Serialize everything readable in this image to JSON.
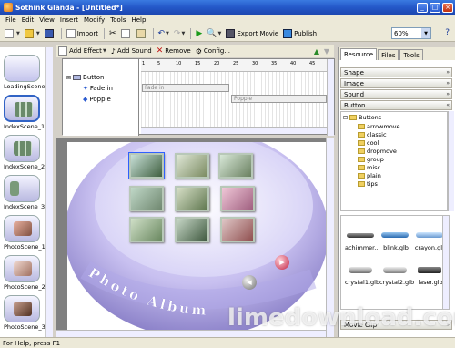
{
  "window": {
    "title": "Sothink Glanda - [Untitled*]"
  },
  "menu": [
    "File",
    "Edit",
    "View",
    "Insert",
    "Modify",
    "Tools",
    "Help"
  ],
  "toolbar": {
    "import_label": "Import",
    "export_label": "Export Movie",
    "publish_label": "Publish",
    "zoom_value": "60%"
  },
  "effects_bar": {
    "add_effect": "Add Effect",
    "add_sound": "Add Sound",
    "remove": "Remove",
    "config": "Config..."
  },
  "timeline": {
    "rows": [
      "Button",
      "Fade in",
      "Popple"
    ],
    "ruler": [
      "1",
      "5",
      "10",
      "15",
      "20",
      "25",
      "30",
      "35",
      "40",
      "45"
    ],
    "bars": [
      "Fade in",
      "Popple"
    ]
  },
  "scenes": [
    "LoadingScene",
    "IndexScene_1",
    "IndexScene_2",
    "IndexScene_3",
    "PhotoScene_1",
    "PhotoScene_2",
    "PhotoScene_3"
  ],
  "canvas": {
    "curve_text": "Photo Album"
  },
  "right_panel": {
    "tabs": [
      "Resource",
      "Files",
      "Tools"
    ],
    "sections": [
      "Shape",
      "Image",
      "Sound",
      "Button"
    ],
    "tree_root": "Buttons",
    "folders": [
      "arrowmove",
      "classic",
      "cool",
      "dropmove",
      "group",
      "misc",
      "plain",
      "tips"
    ],
    "items": [
      "achimmer...",
      "blink.glb",
      "crayon.glb",
      "crystal1.glb",
      "crystal2.glb",
      "laser.glb"
    ],
    "bottom_section": "Movie Clip"
  },
  "status": {
    "text": "For Help, press F1"
  },
  "watermark": "limedownload.com",
  "colors": {
    "titlebar": "#2458c8",
    "canvas_ellipse": "#b8b0e8",
    "selection": "#3163c5"
  }
}
